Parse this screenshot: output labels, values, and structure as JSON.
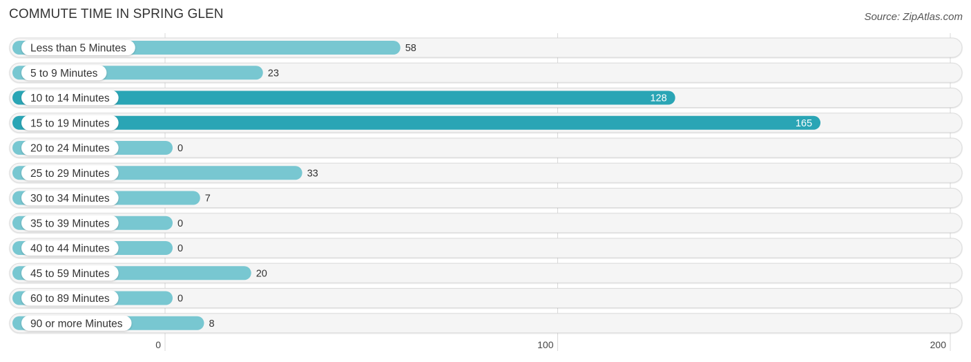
{
  "chart_data": {
    "type": "bar",
    "orientation": "horizontal",
    "title": "COMMUTE TIME IN SPRING GLEN",
    "source": "Source: ZipAtlas.com",
    "categories": [
      "Less than 5 Minutes",
      "5 to 9 Minutes",
      "10 to 14 Minutes",
      "15 to 19 Minutes",
      "20 to 24 Minutes",
      "25 to 29 Minutes",
      "30 to 34 Minutes",
      "35 to 39 Minutes",
      "40 to 44 Minutes",
      "45 to 59 Minutes",
      "60 to 89 Minutes",
      "90 or more Minutes"
    ],
    "values": [
      58,
      23,
      128,
      165,
      0,
      33,
      7,
      0,
      0,
      20,
      0,
      8
    ],
    "xlabel": "",
    "ylabel": "",
    "xlim": [
      0,
      200
    ],
    "xticks": [
      "0",
      "100",
      "200"
    ],
    "grid": true,
    "legend": "none",
    "colors": {
      "bar_normal": "#78c7d1",
      "bar_highlight": "#2aa5b5",
      "track": "#f5f5f5",
      "value_text_outside": "#333333",
      "value_text_inside": "#ffffff"
    }
  }
}
